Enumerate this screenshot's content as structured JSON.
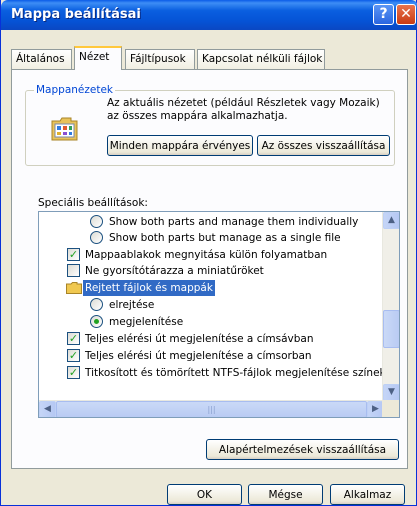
{
  "window": {
    "title": "Mappa beállításai",
    "help_label": "?",
    "close_label": "✕"
  },
  "tabs": [
    {
      "label": "Általános"
    },
    {
      "label": "Nézet"
    },
    {
      "label": "Fájltípusok"
    },
    {
      "label": "Kapcsolat nélküli fájlok"
    }
  ],
  "views": {
    "group_label": "Mappanézetek",
    "description": "Az aktuális nézetet (például Részletek vagy Mozaik) az összes mappára alkalmazhatja.",
    "apply_all_label": "Minden mappára érvényes",
    "reset_all_label": "Az összes visszaállítása"
  },
  "advanced": {
    "label": "Speciális beállítások:",
    "items": [
      {
        "kind": "radio",
        "checked": false,
        "label": "Show both parts and manage them individually"
      },
      {
        "kind": "radio",
        "checked": false,
        "label": "Show both parts but manage as a single file"
      },
      {
        "kind": "checkbox",
        "checked": true,
        "label": "Mappaablakok megnyitása külön folyamatban"
      },
      {
        "kind": "checkbox",
        "checked": false,
        "label": "Ne gyorsítótárazza a miniatűröket"
      },
      {
        "kind": "folder",
        "label": "Rejtett fájlok és mappák"
      },
      {
        "kind": "radio",
        "checked": false,
        "label": "elrejtése"
      },
      {
        "kind": "radio",
        "checked": true,
        "label": "megjelenítése"
      },
      {
        "kind": "checkbox",
        "checked": true,
        "label": "Teljes elérési út megjelenítése a címsávban"
      },
      {
        "kind": "checkbox",
        "checked": true,
        "label": "Teljes elérési út megjelenítése a címsorban"
      },
      {
        "kind": "checkbox",
        "checked": true,
        "label": "Titkosított és tömörített NTFS-fájlok megjelenítése színek"
      }
    ],
    "restore_defaults_label": "Alapértelmezések visszaállítása"
  },
  "footer": {
    "ok_label": "OK",
    "cancel_label": "Mégse",
    "apply_label": "Alkalmaz"
  },
  "colors": {
    "title_bar": "#0553d6",
    "selection": "#316ac5",
    "group_label": "#0046d5",
    "check_mark": "#21a121"
  },
  "icons": {
    "scroll_up": "▲",
    "scroll_down": "▼",
    "scroll_left": "◀",
    "scroll_right": "▶",
    "check": "✓"
  }
}
